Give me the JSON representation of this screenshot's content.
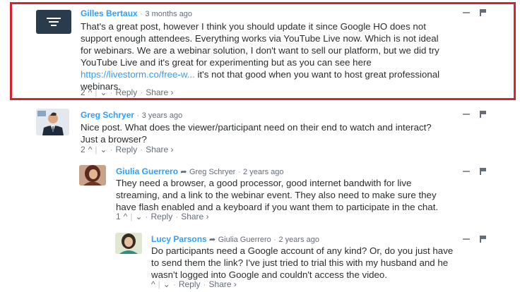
{
  "comments": [
    {
      "author": "Gilles Bertaux",
      "time": "3 months ago",
      "lines": [
        "That's a great post, however I think you should update it since Google HO does not",
        "support enough attendees. Everything works via YouTube Live now. Which is not ideal",
        "for webinars. We are a webinar solution, I don't want to sell our platform, but we did try",
        "YouTube Live and it's great for experimenting but as you can see here",
        "webinars."
      ],
      "link_text": "https://livestorm.co/free-w...",
      "link_tail": " it's not that good when you want to host great professional",
      "votes": "2",
      "reply": "Reply",
      "share": "Share ›"
    },
    {
      "author": "Greg Schryer",
      "time": "3 years ago",
      "lines": [
        "Nice post. What does the viewer/participant need on their end to watch and interact?",
        "Just a browser?"
      ],
      "votes": "2",
      "reply": "Reply",
      "share": "Share ›"
    },
    {
      "author": "Giulia Guerrero",
      "parent": "Greg Schryer",
      "time": "2 years ago",
      "lines": [
        "They need a browser, a good processor, good internet bandwith for live",
        "streaming, and a link to the webinar event. They also need to make sure they",
        "have flash enabled and a keyboard if you want them to participate in the chat."
      ],
      "votes": "1",
      "reply": "Reply",
      "share": "Share ›"
    },
    {
      "author": "Lucy Parsons",
      "parent": "Giulia Guerrero",
      "time": "2 years ago",
      "lines": [
        "Do participants need a Google account of any kind? Or, do you just have",
        "to send them the link? I've just tried to trial this with my husband and he",
        "wasn't logged into Google and couldn't access the video."
      ],
      "votes": "",
      "reply": "Reply",
      "share": "Share ›"
    }
  ],
  "glyphs": {
    "separator": "·",
    "upvote": "^",
    "downvote": "⌄",
    "divider": "|",
    "reply_arrow": "➦"
  },
  "colors": {
    "highlight": "#d8212c",
    "link": "#2e9fff",
    "text": "#2a2e2e",
    "muted": "#656c7a"
  }
}
